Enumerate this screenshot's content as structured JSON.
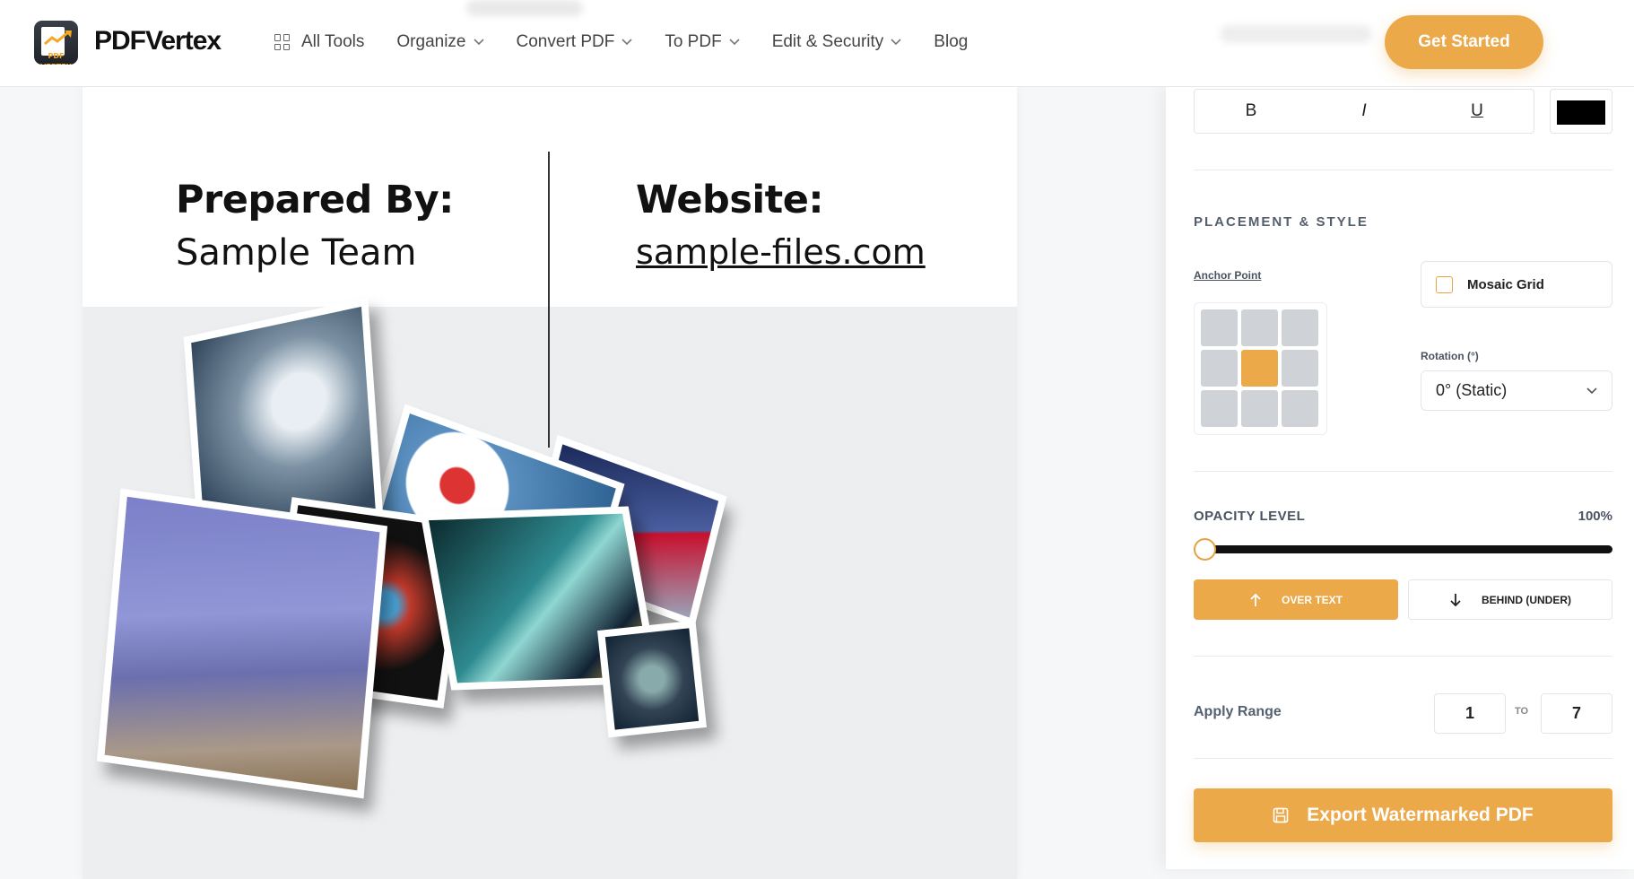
{
  "header": {
    "brand": "PDFVertex",
    "logo_tag": "PDF VERTEX",
    "nav": [
      {
        "label": "All Tools",
        "icon": "grid-icon",
        "dropdown": false
      },
      {
        "label": "Organize",
        "dropdown": true
      },
      {
        "label": "Convert PDF",
        "dropdown": true
      },
      {
        "label": "To PDF",
        "dropdown": true
      },
      {
        "label": "Edit & Security",
        "dropdown": true
      },
      {
        "label": "Blog",
        "dropdown": false
      }
    ],
    "cta": "Get Started"
  },
  "document": {
    "prepared_label": "Prepared By:",
    "prepared_value": "Sample Team",
    "website_label": "Website:",
    "website_value": "sample-files.com"
  },
  "panel": {
    "format": {
      "bold": "B",
      "italic": "I",
      "underline": "U",
      "color": "#000000"
    },
    "placement_title": "PLACEMENT & STYLE",
    "anchor_label": "Anchor Point",
    "anchor_selected": "center",
    "mosaic_label": "Mosaic Grid",
    "mosaic_checked": false,
    "rotation_label": "Rotation (°)",
    "rotation_value": "0° (Static)",
    "opacity_label": "OPACITY LEVEL",
    "opacity_value": "100%",
    "layer_over": "OVER TEXT",
    "layer_under": "BEHIND (UNDER)",
    "range_label": "Apply Range",
    "range_from": "1",
    "range_to_label": "TO",
    "range_to": "7",
    "export_label": "Export Watermarked PDF"
  },
  "colors": {
    "accent": "#eca94a",
    "text": "#111111"
  }
}
